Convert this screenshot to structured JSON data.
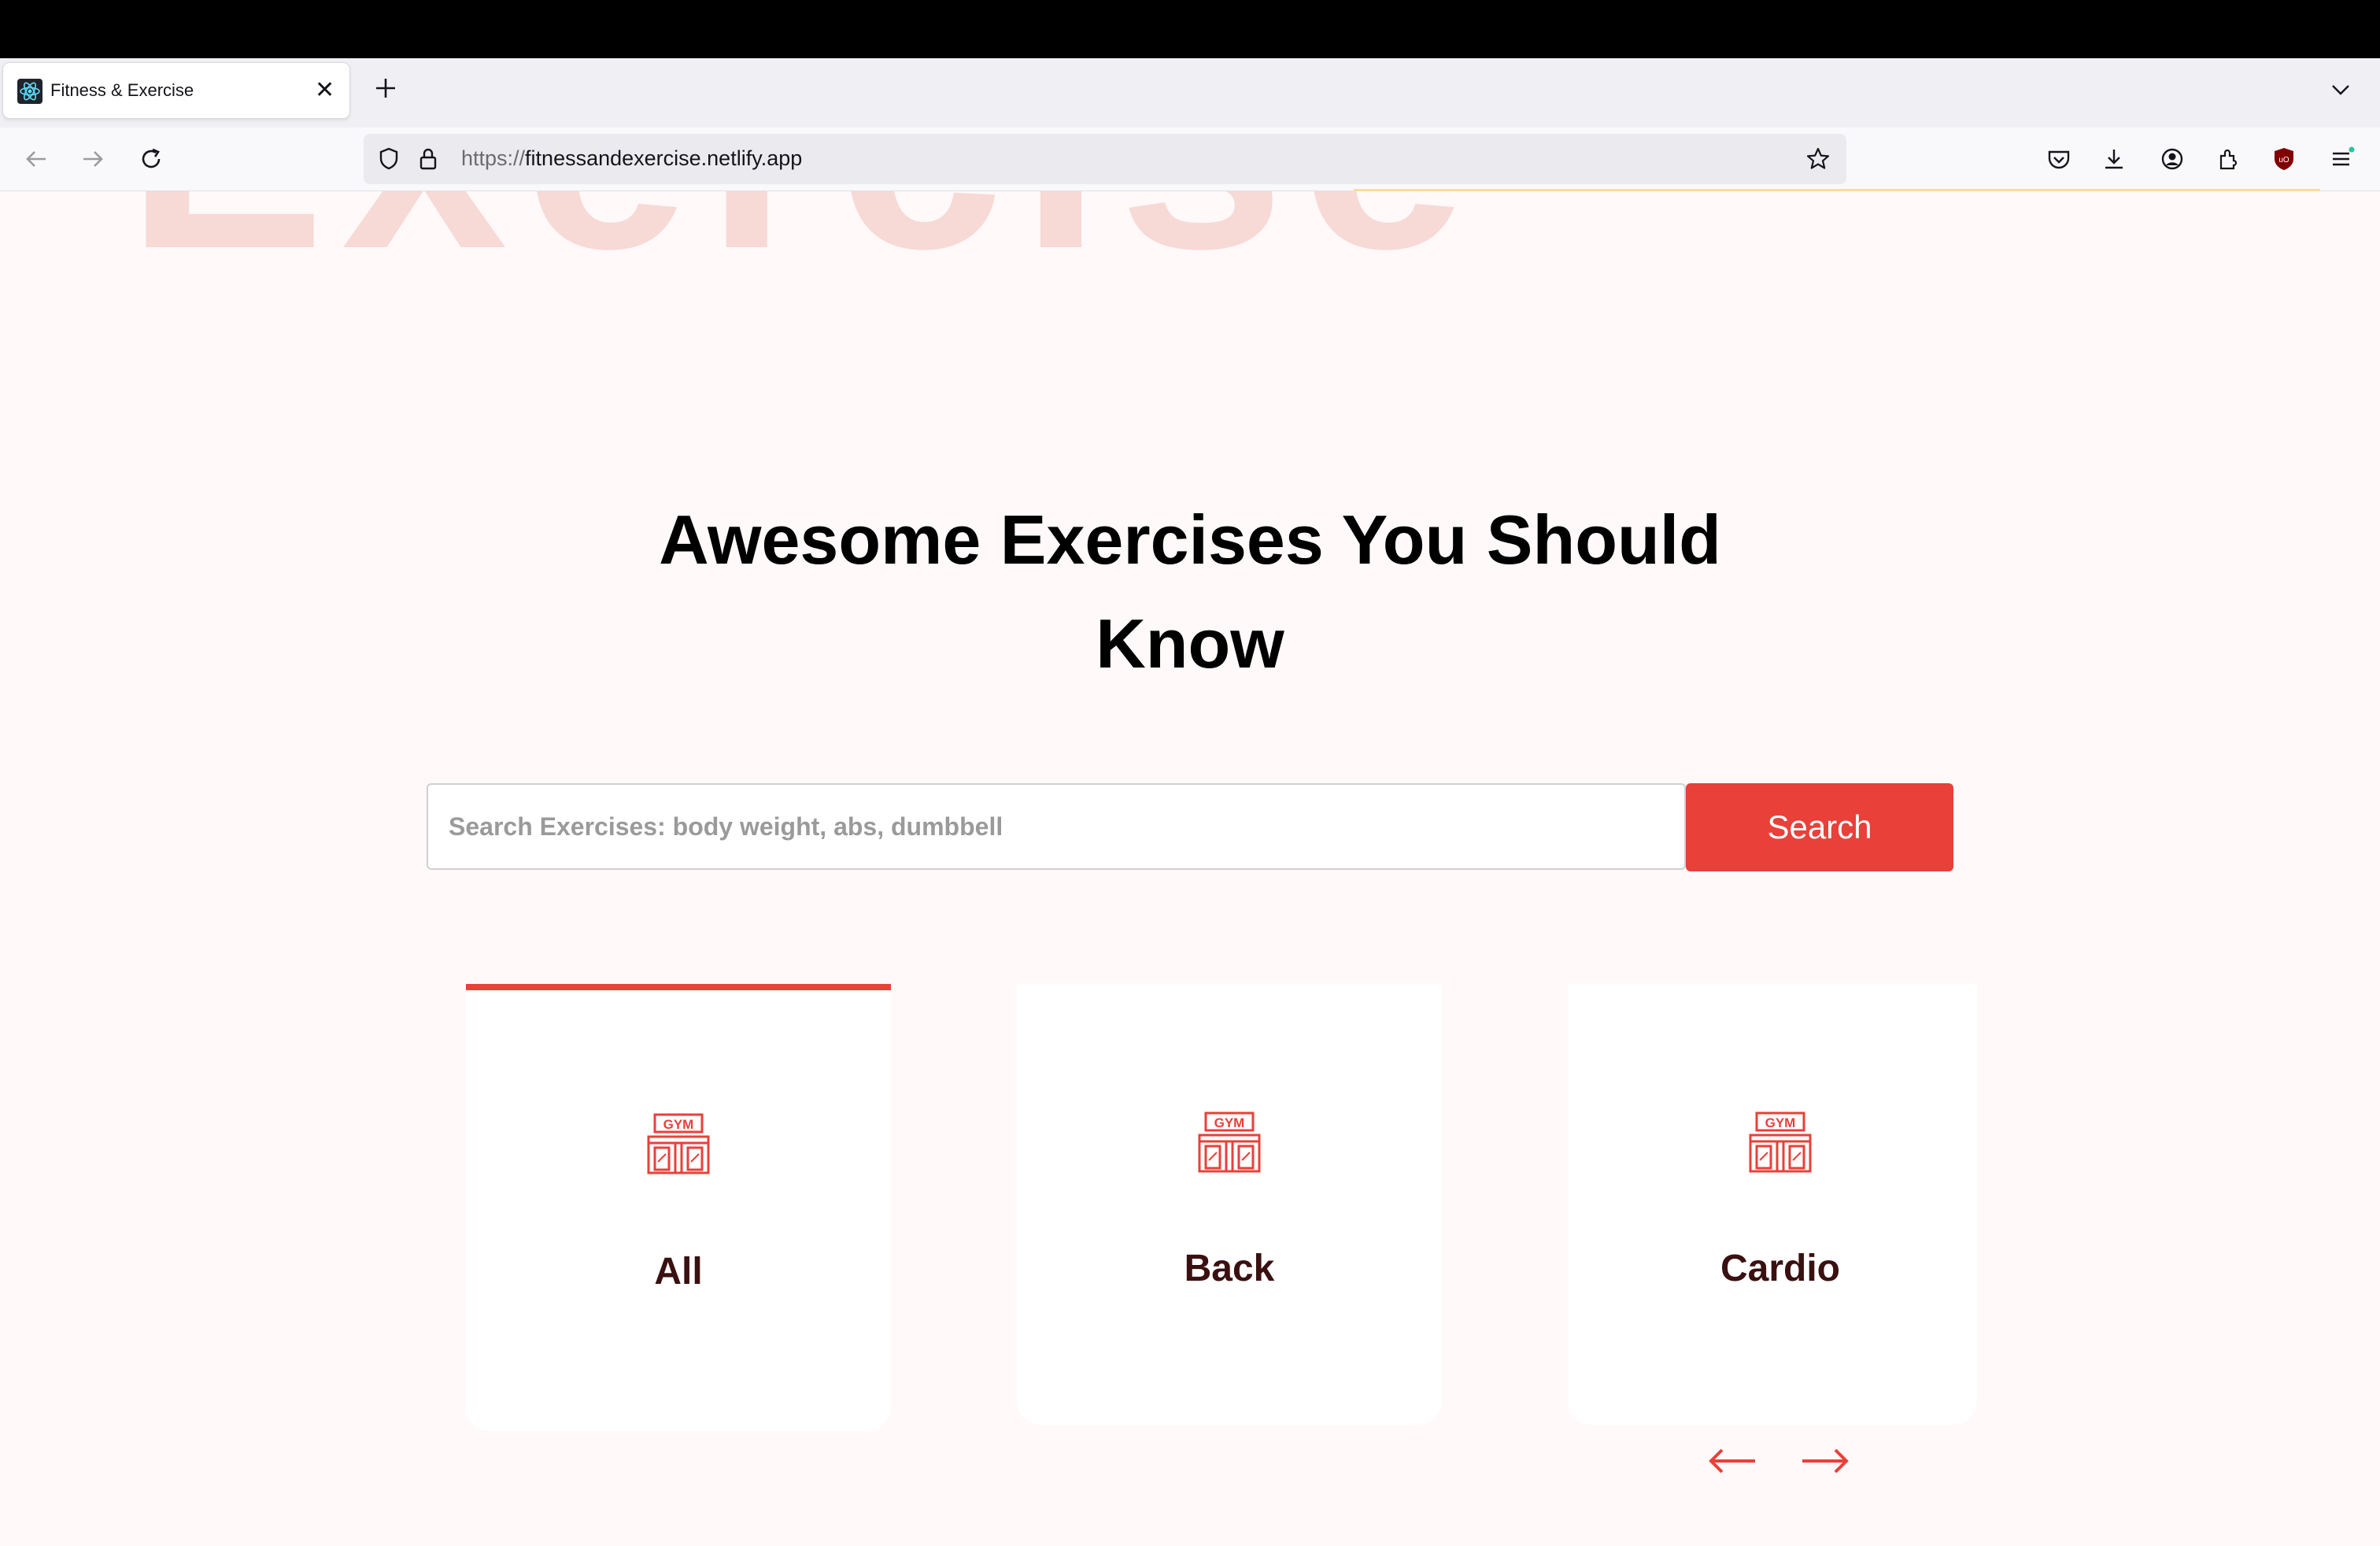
{
  "browser": {
    "tab_title": "Fitness & Exercise",
    "url_scheme": "https://",
    "url_host": "fitnessandexercise.netlify.app"
  },
  "page": {
    "background_word": "Exercise",
    "headline": "Awesome Exercises You Should Know",
    "search": {
      "placeholder": "Search Exercises: body weight, abs, dumbbell",
      "button_label": "Search"
    },
    "categories": [
      {
        "label": "All",
        "icon": "gym-icon",
        "active": true
      },
      {
        "label": "Back",
        "icon": "gym-icon",
        "active": false
      },
      {
        "label": "Cardio",
        "icon": "gym-icon",
        "active": false
      }
    ],
    "icon_text": "GYM"
  },
  "colors": {
    "accent": "#e9403a",
    "page_background": "#fff9f9",
    "category_text": "#3a1010"
  }
}
